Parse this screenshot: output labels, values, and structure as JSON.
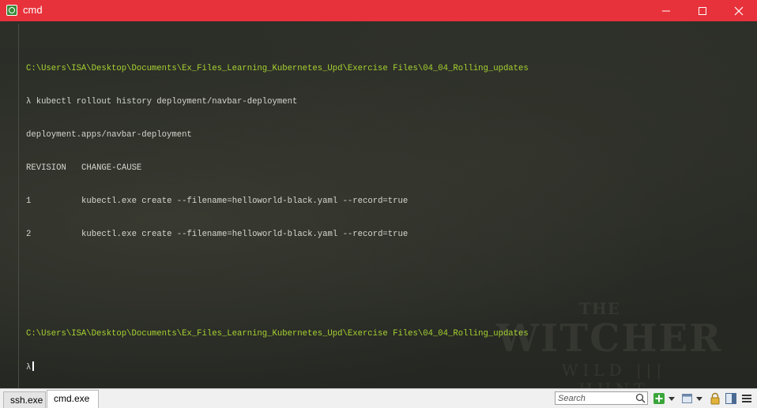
{
  "window": {
    "title": "cmd",
    "title_bar_color": "#e8323b"
  },
  "terminal": {
    "text_color": "#d6d6d0",
    "path_color": "#a6d231",
    "prompt_path_1": "C:\\Users\\ISA\\Desktop\\Documents\\Ex_Files_Learning_Kubernetes_Upd\\Exercise Files\\04_04_Rolling_updates",
    "command_1": "λ kubectl rollout history deployment/navbar-deployment",
    "output_header": "deployment.apps/navbar-deployment",
    "table_headers": [
      "REVISION",
      "CHANGE-CAUSE"
    ],
    "table_rows": [
      [
        "1",
        "kubectl.exe create --filename=helloworld-black.yaml --record=true"
      ],
      [
        "2",
        "kubectl.exe create --filename=helloworld-black.yaml --record=true"
      ]
    ],
    "prompt_path_2": "C:\\Users\\ISA\\Desktop\\Documents\\Ex_Files_Learning_Kubernetes_Upd\\Exercise Files\\04_04_Rolling_updates",
    "prompt_symbol": "λ"
  },
  "watermark": {
    "line1": "THE",
    "line2": "WITCHER",
    "line3": "WILD ||| HUNT"
  },
  "tabs": [
    {
      "label": "ssh.exe",
      "active": false
    },
    {
      "label": "cmd.exe",
      "active": true
    }
  ],
  "search": {
    "placeholder": "Search"
  },
  "icons": {
    "app": "console-icon",
    "minimize": "minimize-icon",
    "maximize": "maximize-icon",
    "close": "close-icon",
    "search": "search-icon",
    "new_console": "plus-icon",
    "dropdown": "chevron-down-icon",
    "view": "window-icon",
    "lock": "lock-icon",
    "layout": "split-view-icon",
    "menu": "hamburger-menu-icon"
  }
}
